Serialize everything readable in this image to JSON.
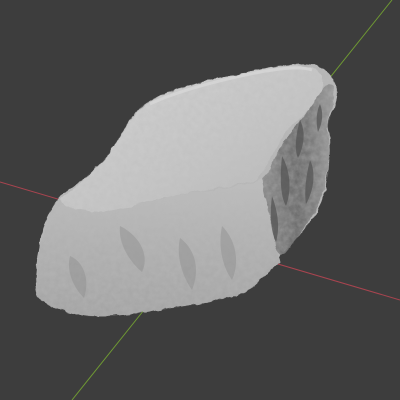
{
  "viewport": {
    "background_color": "#3d3d3d",
    "grid_color": "#454545",
    "x_axis_color": "#a8444f",
    "y_axis_color": "#6f9a33"
  },
  "object": {
    "type": "rock-mesh",
    "base_color": "#bdbdbd",
    "highlight_color": "#d2d2d2",
    "shadow_color": "#6e6e6e"
  }
}
